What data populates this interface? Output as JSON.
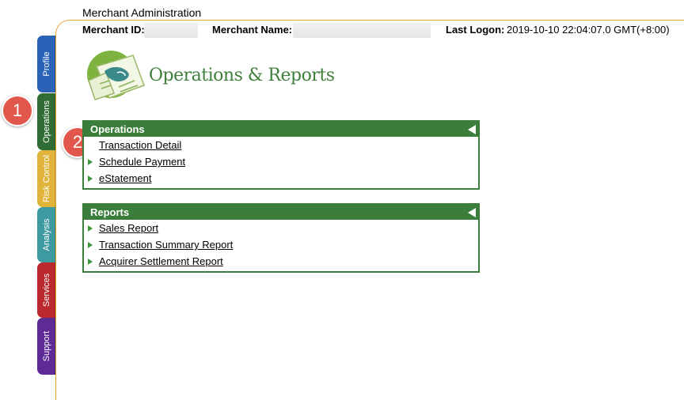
{
  "app": {
    "title": "Merchant Administration"
  },
  "info": {
    "merchant_id_label": "Merchant ID:",
    "merchant_name_label": "Merchant Name:",
    "last_logon_label": "Last Logon:",
    "last_logon_value": "2019-10-10 22:04:07.0 GMT(+8:00)"
  },
  "tabs": [
    {
      "label": "Profile",
      "color": "#2a62b7"
    },
    {
      "label": "Operations",
      "color": "#2f6d35"
    },
    {
      "label": "Risk Control",
      "color": "#e0b43a"
    },
    {
      "label": "Analysis",
      "color": "#3d9aa0"
    },
    {
      "label": "Services",
      "color": "#b9292e"
    },
    {
      "label": "Support",
      "color": "#5e2a96"
    }
  ],
  "callouts": [
    "1",
    "2"
  ],
  "hero": {
    "title": "Operations & Reports",
    "icon": "map-document-icon"
  },
  "operations": {
    "header": "Operations",
    "items": [
      "Transaction Detail",
      "Schedule Payment",
      "eStatement"
    ]
  },
  "reports": {
    "header": "Reports",
    "items": [
      "Sales Report",
      "Transaction Summary Report",
      "Acquirer Settlement Report"
    ]
  },
  "colors": {
    "panel_green": "#3b7d3a",
    "frame_orange": "#e8a33a",
    "callout_red": "#e2574c"
  }
}
